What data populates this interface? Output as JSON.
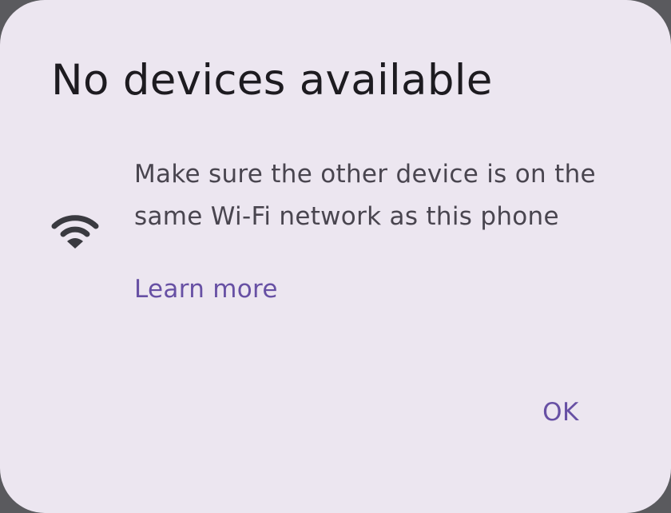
{
  "dialog": {
    "title": "No devices available",
    "icon": "wifi-icon",
    "message": "Make sure the other device is on the same Wi-Fi network as this phone",
    "link_label": "Learn more",
    "ok_label": "OK"
  },
  "colors": {
    "surface": "#ece6f0",
    "title_text": "#1d1b20",
    "body_text": "#49454f",
    "icon": "#3a3a40",
    "accent": "#6750a4",
    "scrim": "#5a5a5e"
  }
}
